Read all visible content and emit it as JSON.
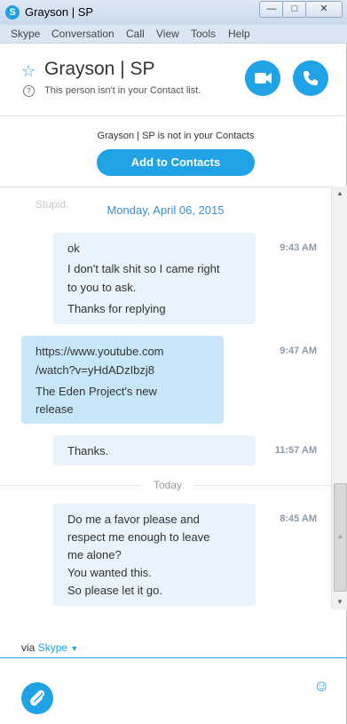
{
  "window": {
    "title": "Grayson | SP"
  },
  "menu": [
    "Skype",
    "Conversation",
    "Call",
    "View",
    "Tools",
    "Help"
  ],
  "header": {
    "contact_name": "Grayson | SP",
    "status": "This person isn't in your Contact list."
  },
  "notice": {
    "text": "Grayson | SP is not in your Contacts",
    "button": "Add to Contacts"
  },
  "conversation": {
    "ghost_text": "Stupid.",
    "date": "Monday, April 06, 2015",
    "messages": [
      {
        "from": "me",
        "lines": [
          "ok",
          "I don't talk shit so I came right",
          "to you to ask.",
          "Thanks for replying"
        ],
        "time": "9:43 AM"
      },
      {
        "from": "contact",
        "lines": [
          "https://www.youtube.com",
          "/watch?v=yHdADzIbzj8",
          "The Eden Project's new",
          "release"
        ],
        "time": "9:47 AM"
      },
      {
        "from": "me",
        "lines": [
          "Thanks."
        ],
        "time": "11:57 AM"
      },
      {
        "from": "me",
        "lines": [
          "Do me a favor please and",
          "respect me enough to leave",
          "me alone?",
          "You wanted this.",
          "So please let it go."
        ],
        "time": "8:45 AM"
      }
    ],
    "today_label": "Today"
  },
  "footer": {
    "via_prefix": "via",
    "via_link": "Skype"
  },
  "colors": {
    "accent": "#1fa3e6",
    "bubble_me": "#e8f3fb",
    "bubble_contact": "#c7e7f8"
  }
}
